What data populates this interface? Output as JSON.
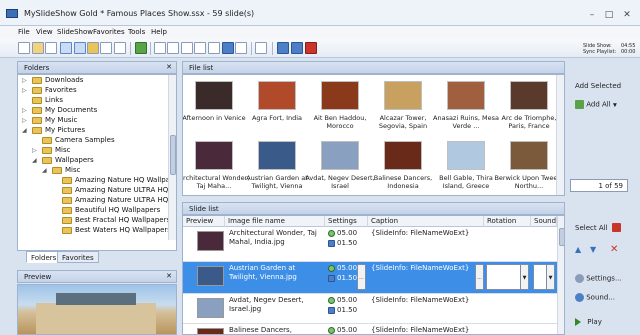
{
  "window": {
    "title": "MySlideShow Gold * Famous Places Show.ssx - 59 slide(s)",
    "controls": [
      "–",
      "□",
      "✕"
    ]
  },
  "menu": [
    "File",
    "View",
    "SlideShow",
    "Favorites",
    "Tools",
    "Help"
  ],
  "toolbar": {
    "slide_show_label": "Slide Show:",
    "slide_show_value": "04:55",
    "sync_label": "Sync Playlist:",
    "sync_value": "00:00"
  },
  "folders": {
    "header": "Folders",
    "items": [
      {
        "label": "Downloads"
      },
      {
        "label": "Favorites"
      },
      {
        "label": "Links"
      },
      {
        "label": "My Documents"
      },
      {
        "label": "My Music"
      },
      {
        "label": "My Pictures"
      },
      {
        "label": "Camera Samples"
      },
      {
        "label": "Misc"
      },
      {
        "label": "Wallpapers"
      },
      {
        "label": "Misc"
      },
      {
        "label": "Amazing Nature HQ Wallpaper"
      },
      {
        "label": "Amazing Nature ULTRA HQ W"
      },
      {
        "label": "Amazing Nature ULTRA HQ W"
      },
      {
        "label": "Beautiful HQ Wallpapers"
      },
      {
        "label": "Best Fractal HQ Wallpapers"
      },
      {
        "label": "Best Waters HQ Wallpapers"
      }
    ],
    "tabs": [
      "Folders",
      "Favorites"
    ]
  },
  "preview": {
    "header": "Preview"
  },
  "filelist": {
    "header": "File list",
    "items": [
      {
        "caption": "Afternoon in Venice",
        "color": "#3a2a2a"
      },
      {
        "caption": "Agra Fort, India",
        "color": "#b04a2a"
      },
      {
        "caption": "Ait Ben Haddou, Morocco",
        "color": "#8a3a1a"
      },
      {
        "caption": "Alcazar Tower, Segovia, Spain",
        "color": "#c8a060"
      },
      {
        "caption": "Anasazi Ruins, Mesa Verde ...",
        "color": "#a06040"
      },
      {
        "caption": "Arc de Triomphe, Paris, France",
        "color": "#5a3a2a"
      },
      {
        "caption": "Architectural Wonder, Taj Maha...",
        "color": "#4a2a3a"
      },
      {
        "caption": "Austrian Garden at Twilight, Vienna",
        "color": "#3a5a8a"
      },
      {
        "caption": "Avdat, Negev Desert, Israel",
        "color": "#8aa0c0"
      },
      {
        "caption": "Balinese Dancers, Indonesia",
        "color": "#6a2a1a"
      },
      {
        "caption": "Bell Gable, Thira Island, Greece",
        "color": "#b0c8e0"
      },
      {
        "caption": "Berwick Upon Tweed, Northu...",
        "color": "#7a5a3a"
      }
    ],
    "rail": {
      "add_selected": "Add Selected",
      "add_all": "Add All",
      "page": "1 of 59"
    }
  },
  "slidelist": {
    "header": "Slide list",
    "columns": [
      "Preview",
      "Image file name",
      "Settings",
      "Caption",
      "Rotation",
      "Sound"
    ],
    "rows": [
      {
        "name": "Architectural Wonder, Taj Mahal, India.jpg",
        "t1": "05.00",
        "t2": "01.50",
        "caption": "{SlideInfo: FileNameWoExt}",
        "selected": false,
        "color": "#4a2a3a"
      },
      {
        "name": "Austrian Garden at Twilight, Vienna.jpg",
        "t1": "05.00",
        "t2": "01.50",
        "caption": "{SlideInfo: FileNameWoExt}",
        "selected": true,
        "color": "#3a5a8a"
      },
      {
        "name": "Avdat, Negev Desert, Israel.jpg",
        "t1": "05.00",
        "t2": "01.50",
        "caption": "{SlideInfo: FileNameWoExt}",
        "selected": false,
        "color": "#8aa0c0"
      },
      {
        "name": "Balinese Dancers, Indonesia.jpg",
        "t1": "05.00",
        "t2": "",
        "caption": "{SlideInfo: FileNameWoExt}",
        "selected": false,
        "color": "#6a2a1a"
      }
    ],
    "rail": {
      "select_all": "Select All",
      "settings": "Settings...",
      "sound": "Sound...",
      "play": "Play"
    }
  }
}
